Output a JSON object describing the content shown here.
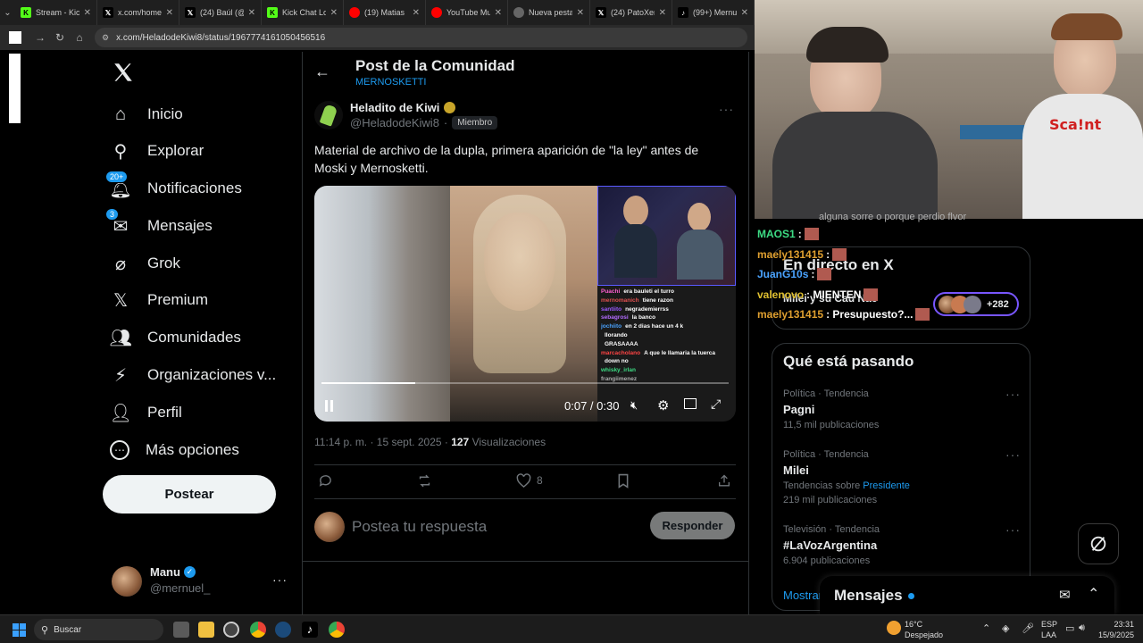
{
  "browser": {
    "tabs": [
      {
        "label": "Stream - Kic",
        "favicon": "kick-icon",
        "color": "#53fc18"
      },
      {
        "label": "x.com/home",
        "favicon": "x-icon",
        "color": "#000000"
      },
      {
        "label": "(24) Baúl (@",
        "favicon": "x-icon",
        "color": "#000000"
      },
      {
        "label": "Kick Chat Lo",
        "favicon": "kick-icon",
        "color": "#53fc18"
      },
      {
        "label": "(19) Matias ",
        "favicon": "youtube-icon",
        "color": "#ff0000"
      },
      {
        "label": "YouTube Mu",
        "favicon": "youtube-music-icon",
        "color": "#ff0000"
      },
      {
        "label": "Nueva pesta",
        "favicon": "chrome-icon",
        "color": "#8ab4f8"
      },
      {
        "label": "(24) PatoXer",
        "favicon": "x-icon",
        "color": "#000000"
      },
      {
        "label": "(99+) Mernu",
        "favicon": "tiktok-icon",
        "color": "#000000"
      }
    ],
    "url": "x.com/HeladodeKiwi8/status/1967774161050456516"
  },
  "sidebar": {
    "items": [
      {
        "label": "Inicio",
        "icon": "home-icon"
      },
      {
        "label": "Explorar",
        "icon": "search-icon"
      },
      {
        "label": "Notificaciones",
        "icon": "bell-icon",
        "badge": "20+"
      },
      {
        "label": "Mensajes",
        "icon": "mail-icon",
        "badge": "3"
      },
      {
        "label": "Grok",
        "icon": "grok-icon"
      },
      {
        "label": "Premium",
        "icon": "x-icon"
      },
      {
        "label": "Comunidades",
        "icon": "people-icon"
      },
      {
        "label": "Organizaciones v...",
        "icon": "lightning-icon"
      },
      {
        "label": "Perfil",
        "icon": "person-icon"
      },
      {
        "label": "Más opciones",
        "icon": "more-circle-icon"
      }
    ],
    "post_button": "Postear",
    "profile": {
      "name": "Manu",
      "handle": "@mernuel_"
    }
  },
  "main": {
    "header_title": "Post de la Comunidad",
    "header_subtitle": "MERNOSKETTI",
    "author": {
      "name": "Heladito de Kiwi",
      "handle": "@HeladodeKiwi8",
      "separator": "·",
      "member_badge": "Miembro"
    },
    "text": "Material de archivo de la dupla, primera aparición de \"la ley\" antes de Moski y Mernosketti.",
    "video": {
      "time": "0:07 / 0:30",
      "progress": 0.23,
      "chat_lines": [
        {
          "user": "Puachi",
          "msg": "era bauleti el turro",
          "color": "#ff5fd2"
        },
        {
          "user": "mernomanich",
          "msg": "tiene razon",
          "color": "#e05050"
        },
        {
          "user": "santiito",
          "msg": "negrademierrss",
          "color": "#9b59ff"
        },
        {
          "user": "sebagrosi",
          "msg": "la banco",
          "color": "#b36bff"
        },
        {
          "user": "jochiito",
          "msg": "en 2 dias hace un 4 k",
          "color": "#4aa3ff"
        },
        {
          "user": "",
          "msg": "llorando",
          "color": "#ffffff"
        },
        {
          "user": "",
          "msg": "GRASAAAA",
          "color": "#ffffff"
        },
        {
          "user": "marcacholano",
          "msg": "A que le llamaria la tuerca",
          "color": "#ff4444"
        },
        {
          "user": "",
          "msg": "down no",
          "color": "#ffffff"
        },
        {
          "user": "whisky_irlan",
          "msg": "",
          "color": "#3ddc84"
        },
        {
          "user": "frangiimenez",
          "msg": "",
          "color": "#aaaaaa"
        }
      ]
    },
    "timestamp": "11:14 p. m. · 15 sept. 2025 · ",
    "views_count": "127",
    "views_label": " Visualizaciones",
    "likes": "8",
    "reply_placeholder": "Postea tu respuesta",
    "reply_button": "Responder"
  },
  "right": {
    "partial_top_text": "alguna sorre o porque perdio flvor",
    "chat_overlay": [
      {
        "user": "MAOS1",
        "text": ":",
        "color": "#3ddc84"
      },
      {
        "user": "maely131415",
        "text": ":",
        "color": "#e0a030"
      },
      {
        "user": "JuanG10s",
        "text": ":",
        "color": "#4aa3ff"
      },
      {
        "user": "valenovo",
        "text": ": MIENTEN",
        "color": "#e0c030"
      },
      {
        "user": "maely131415",
        "text": ": Presupuesto?...",
        "color": "#e0a030"
      }
    ],
    "live_title": "En directo en X",
    "live_partial": "Milei y su Cau Nac",
    "live_count": "+282",
    "trends_title": "Qué está pasando",
    "trends": [
      {
        "meta": "Política · Tendencia",
        "name": "Pagni",
        "extra": "",
        "extra_link": "",
        "count": "11,5 mil publicaciones"
      },
      {
        "meta": "Política · Tendencia",
        "name": "Milei",
        "extra": "Tendencias sobre ",
        "extra_link": "Presidente",
        "count": "219 mil publicaciones"
      },
      {
        "meta": "Televisión · Tendencia",
        "name": "#LaVozArgentina",
        "extra": "",
        "extra_link": "",
        "count": "6.904 publicaciones"
      }
    ],
    "show_more": "Mostrar",
    "messages_label": "Mensajes"
  },
  "taskbar": {
    "search_placeholder": "Buscar",
    "weather_temp": "16°C",
    "weather_desc": "Despejado",
    "lang_top": "ESP",
    "lang_bottom": "LAA",
    "time": "23:31",
    "date": "15/9/2025"
  }
}
